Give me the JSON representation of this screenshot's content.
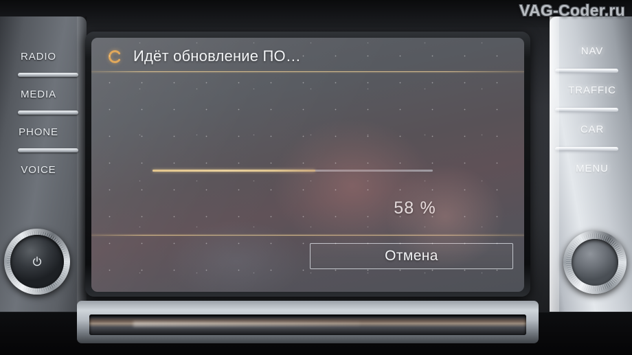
{
  "watermark": {
    "text": "VAG-Coder.ru"
  },
  "left_panel": {
    "buttons": [
      {
        "label": "RADIO",
        "name": "radio-button"
      },
      {
        "label": "MEDIA",
        "name": "media-button"
      },
      {
        "label": "PHONE",
        "name": "phone-button"
      },
      {
        "label": "VOICE",
        "name": "voice-button"
      }
    ],
    "knob": {
      "name": "power-volume-knob",
      "icon": "power-icon"
    }
  },
  "right_panel": {
    "buttons": [
      {
        "label": "NAV",
        "name": "nav-button"
      },
      {
        "label": "TRAFFIC",
        "name": "traffic-button"
      },
      {
        "label": "CAR",
        "name": "car-button"
      },
      {
        "label": "MENU",
        "name": "menu-button"
      }
    ],
    "knob": {
      "name": "tune-knob",
      "icon": "none"
    }
  },
  "screen": {
    "title": "Идёт обновление ПО…",
    "spinner_icon": "loading-spinner-icon",
    "progress": {
      "percent_label": "58 %",
      "percent_value": 58,
      "fill_color": "#e2c489",
      "track_color": "#cdd0d6"
    },
    "cancel_button": {
      "label": "Отмена"
    },
    "divider_color": "#e2c48c",
    "accent_color": "#e2c489"
  },
  "media_slot": {
    "name": "cd-slot"
  }
}
